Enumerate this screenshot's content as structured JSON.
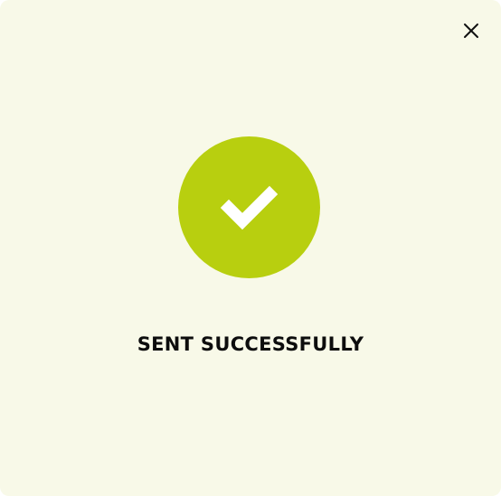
{
  "dialog": {
    "message": "SENT SUCCESSFULLY",
    "close_icon": "close-icon",
    "status_icon": "checkmark-icon"
  },
  "colors": {
    "background": "#f8f9e8",
    "accent": "#b8cf0f",
    "check": "#ffffff",
    "text": "#0d0d0d",
    "close": "#111111"
  }
}
